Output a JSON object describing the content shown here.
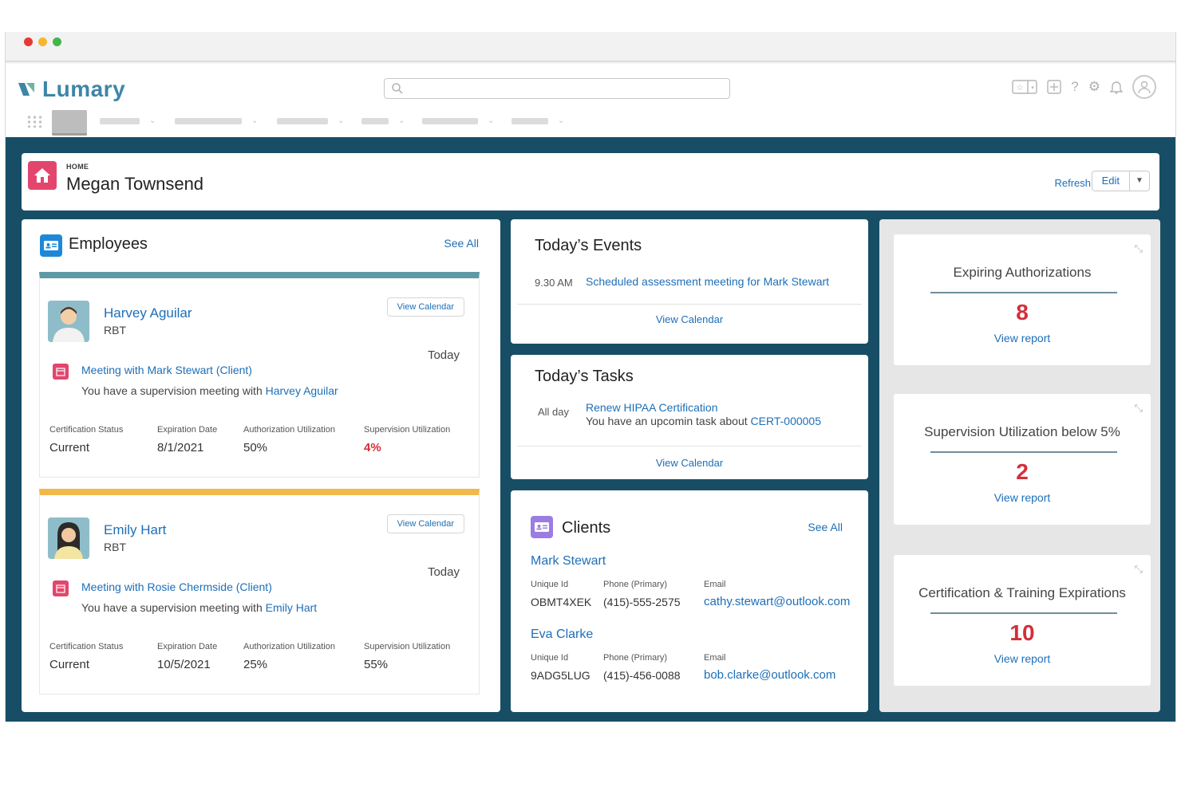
{
  "app": {
    "brand": "Lumary",
    "search_placeholder": ""
  },
  "home": {
    "kicker": "HOME",
    "title": "Megan Townsend",
    "refresh_label": "Refresh",
    "edit_label": "Edit"
  },
  "employees": {
    "title": "Employees",
    "see_all": "See All",
    "cards": [
      {
        "name": "Harvey Aguilar",
        "role": "RBT",
        "view_calendar": "View Calendar",
        "day": "Today",
        "meeting": "Meeting with Mark Stewart (Client)",
        "desc_prefix": "You have a supervision meeting with",
        "desc_link": "Harvey Aguilar",
        "stats": [
          {
            "label": "Certification Status",
            "value": "Current"
          },
          {
            "label": "Expiration Date",
            "value": "8/1/2021"
          },
          {
            "label": "Authorization Utilization",
            "value": "50%"
          },
          {
            "label": "Supervision Utilization",
            "value": "4%"
          }
        ]
      },
      {
        "name": "Emily Hart",
        "role": "RBT",
        "view_calendar": "View Calendar",
        "day": "Today",
        "meeting": "Meeting with Rosie Chermside (Client)",
        "desc_prefix": "You have a supervision meeting with",
        "desc_link": "Emily Hart",
        "stats": [
          {
            "label": "Certification Status",
            "value": "Current"
          },
          {
            "label": "Expiration Date",
            "value": "10/5/2021"
          },
          {
            "label": "Authorization Utilization",
            "value": "25%"
          },
          {
            "label": "Supervision Utilization",
            "value": "55%"
          }
        ]
      }
    ]
  },
  "events": {
    "title": "Today’s Events",
    "time": "9.30 AM",
    "item": "Scheduled assessment meeting for Mark Stewart",
    "view_calendar": "View Calendar"
  },
  "tasks": {
    "title": "Today’s Tasks",
    "time": "All day",
    "item": "Renew HIPAA Certification",
    "desc_prefix": "You have an upcomin task about",
    "desc_link": "CERT-000005",
    "view_calendar": "View Calendar"
  },
  "clients": {
    "title": "Clients",
    "see_all": "See All",
    "labels": {
      "unique_id": "Unique Id",
      "phone": "Phone (Primary)",
      "email": "Email"
    },
    "items": [
      {
        "name": "Mark Stewart",
        "unique_id": "OBMT4XEK",
        "phone": "(415)-555-2575",
        "email": "cathy.stewart@outlook.com"
      },
      {
        "name": "Eva Clarke",
        "unique_id": "9ADG5LUG",
        "phone": "(415)-456-0088",
        "email": "bob.clarke@outlook.com"
      }
    ]
  },
  "stats": [
    {
      "title": "Expiring Authorizations",
      "value": "8",
      "link": "View report"
    },
    {
      "title": "Supervision Utilization below 5%",
      "value": "2",
      "link": "View report"
    },
    {
      "title": "Certification & Training Expirations",
      "value": "10",
      "link": "View report"
    }
  ],
  "colors": {
    "brand": "#3d86a8",
    "link": "#1d6fb8",
    "alert": "#d32f3a",
    "content_bg": "#174e66",
    "home_icon": "#e3466d"
  }
}
